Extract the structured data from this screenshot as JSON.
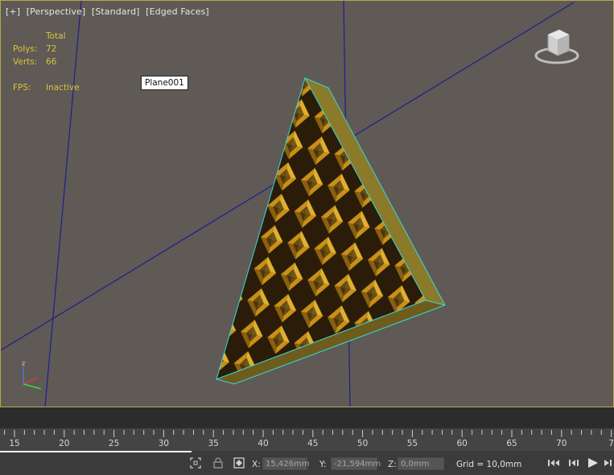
{
  "viewport": {
    "menu": [
      "[+]",
      "[Perspective]",
      "[Standard]",
      "[Edged Faces]"
    ],
    "stats": {
      "total_label": "Total",
      "polys_label": "Polys:",
      "polys_value": "72",
      "verts_label": "Verts:",
      "verts_value": "66",
      "fps_label": "FPS:",
      "fps_value": "Inactive"
    },
    "object_label": "Plane001",
    "viewcube_icon": "viewcube-icon",
    "axis_letter": "z",
    "colors": {
      "background": "#5f5a55",
      "border": "#b8a64a",
      "stats_text": "#d8c43c",
      "grid_line": "#1a1a8a",
      "edge_highlight": "#38d8d8"
    }
  },
  "timeline": {
    "ruler_labels": [
      "15",
      "20",
      "25",
      "30",
      "35",
      "40",
      "45",
      "50",
      "55",
      "60",
      "65",
      "70",
      "7"
    ]
  },
  "statusbar": {
    "x_label": "X:",
    "x_value": "15,426mm",
    "y_label": "Y:",
    "y_value": "-21,594mm",
    "z_label": "Z:",
    "z_value": "0,0mm",
    "grid_text": "Grid = 10,0mm",
    "icons": {
      "selection": "selection-bracket-icon",
      "lock": "lock-icon",
      "transform_mode": "absolute-mode-icon",
      "go_start": "go-to-start-icon",
      "prev_frame": "previous-frame-icon",
      "play": "play-icon",
      "next_frame": "next-frame-icon"
    }
  }
}
